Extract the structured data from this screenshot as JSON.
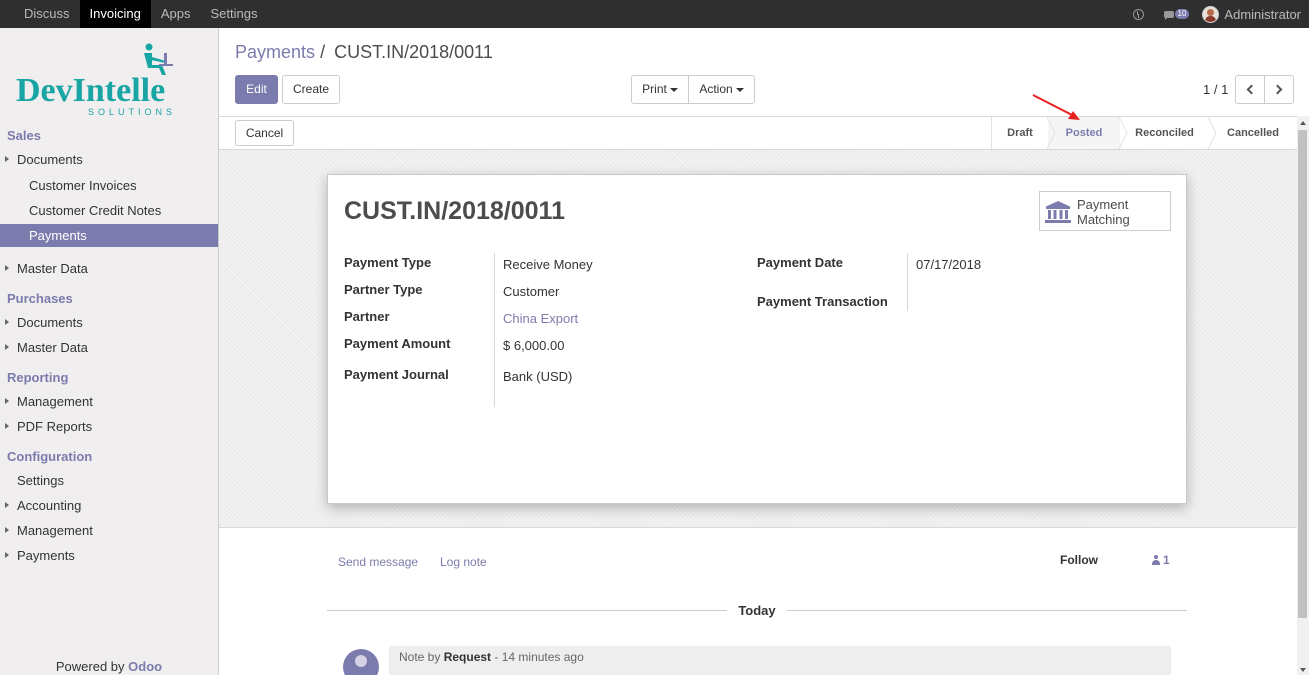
{
  "topbar": {
    "menu": [
      "Discuss",
      "Invoicing",
      "Apps",
      "Settings"
    ],
    "notification_count": "10",
    "user": "Administrator"
  },
  "sidebar": {
    "sales": "Sales",
    "sales_documents": "Documents",
    "customer_invoices": "Customer Invoices",
    "customer_credit_notes": "Customer Credit Notes",
    "payments": "Payments",
    "sales_master_data": "Master Data",
    "purchases": "Purchases",
    "purchases_documents": "Documents",
    "purchases_master_data": "Master Data",
    "reporting": "Reporting",
    "management": "Management",
    "pdf_reports": "PDF Reports",
    "configuration": "Configuration",
    "settings": "Settings",
    "accounting": "Accounting",
    "config_management": "Management",
    "config_payments": "Payments",
    "powered_prefix": "Powered by",
    "powered_brand": "Odoo",
    "logo_text": "DevIntelle",
    "logo_sub": "SOLUTIONS"
  },
  "breadcrumb": {
    "parent": "Payments",
    "separator": "/",
    "current": "CUST.IN/2018/0011"
  },
  "buttons": {
    "edit": "Edit",
    "create": "Create",
    "print": "Print",
    "action": "Action",
    "cancel": "Cancel"
  },
  "pager": {
    "value": "1 / 1"
  },
  "status": {
    "steps": [
      "Draft",
      "Posted",
      "Reconciled",
      "Cancelled"
    ],
    "active": "Posted"
  },
  "form": {
    "title": "CUST.IN/2018/0011",
    "smart_button": {
      "line1": "Payment",
      "line2": "Matching"
    },
    "left_fields": [
      {
        "label": "Payment Type",
        "value": "Receive Money"
      },
      {
        "label": "Partner Type",
        "value": "Customer"
      },
      {
        "label": "Partner",
        "value": "China Export"
      },
      {
        "label": "Payment Amount",
        "value": "$ 6,000.00"
      },
      {
        "label": "Payment Journal",
        "value": "Bank (USD)"
      }
    ],
    "right_fields": [
      {
        "label": "Payment Date",
        "value": "07/17/2018"
      },
      {
        "label": "Payment Transaction",
        "value": ""
      }
    ]
  },
  "chatter": {
    "send_message": "Send message",
    "log_note": "Log note",
    "follow": "Follow",
    "followers_count": "1",
    "today": "Today",
    "message": {
      "prefix": "Note by",
      "author": "Request",
      "time": "- 14 minutes ago"
    }
  },
  "colors": {
    "accent": "#7c7bad",
    "topbar": "#2f2f2f",
    "annotation_arrow": "#e82020"
  }
}
